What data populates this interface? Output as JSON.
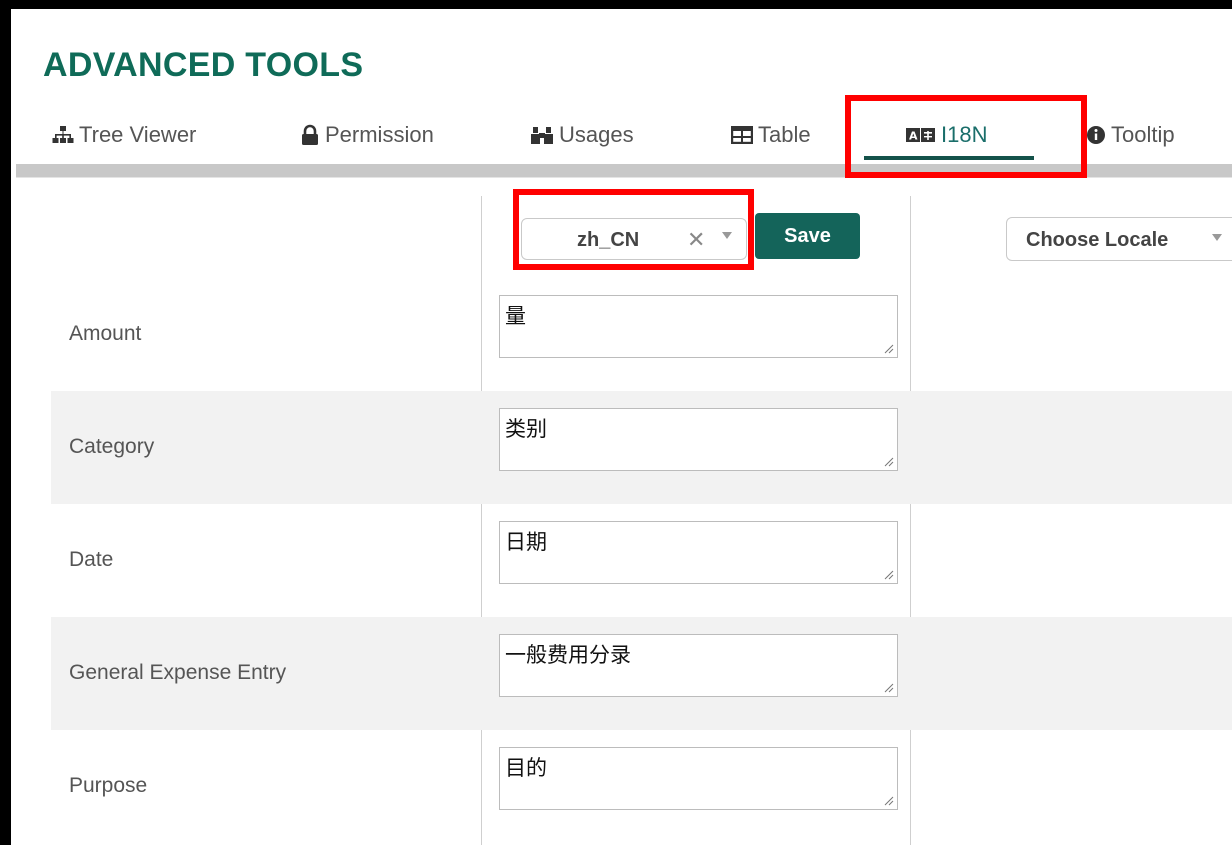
{
  "page": {
    "title": "ADVANCED TOOLS"
  },
  "tabs": [
    {
      "label": "Tree Viewer",
      "icon": "sitemap-icon"
    },
    {
      "label": "Permission",
      "icon": "lock-icon"
    },
    {
      "label": "Usages",
      "icon": "binoculars-icon"
    },
    {
      "label": "Table",
      "icon": "table-icon"
    },
    {
      "label": "I18N",
      "icon": "language-icon",
      "active": true
    },
    {
      "label": "Tooltip",
      "icon": "info-icon"
    }
  ],
  "locale_select": {
    "value": "zh_CN",
    "clear_symbol": "✕"
  },
  "save_button": {
    "label": "Save"
  },
  "compare_locale": {
    "placeholder": "Choose Locale"
  },
  "rows": [
    {
      "label": "Amount",
      "value": "量"
    },
    {
      "label": "Category",
      "value": "类别"
    },
    {
      "label": "Date",
      "value": "日期"
    },
    {
      "label": "General Expense Entry",
      "value": "一般费用分录"
    },
    {
      "label": "Purpose",
      "value": "目的"
    }
  ],
  "colors": {
    "brand": "#0f6b58",
    "button": "#14645a",
    "highlight": "#ff0000",
    "row_shade": "#f2f2f2"
  }
}
